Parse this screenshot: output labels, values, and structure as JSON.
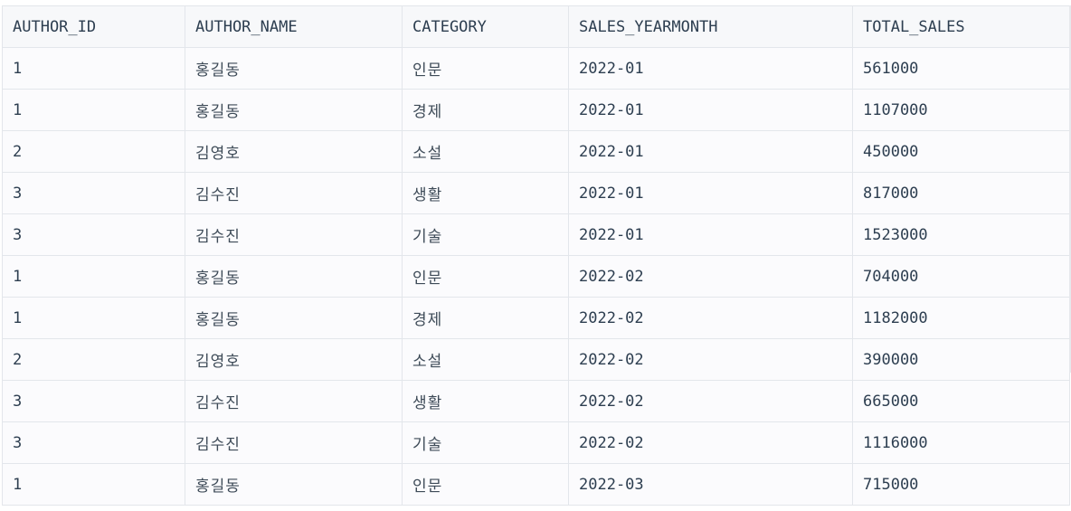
{
  "table": {
    "columns": [
      "AUTHOR_ID",
      "AUTHOR_NAME",
      "CATEGORY",
      "SALES_YEARMONTH",
      "TOTAL_SALES"
    ],
    "rows": [
      [
        "1",
        "홍길동",
        "인문",
        "2022-01",
        "561000"
      ],
      [
        "1",
        "홍길동",
        "경제",
        "2022-01",
        "1107000"
      ],
      [
        "2",
        "김영호",
        "소설",
        "2022-01",
        "450000"
      ],
      [
        "3",
        "김수진",
        "생활",
        "2022-01",
        "817000"
      ],
      [
        "3",
        "김수진",
        "기술",
        "2022-01",
        "1523000"
      ],
      [
        "1",
        "홍길동",
        "인문",
        "2022-02",
        "704000"
      ],
      [
        "1",
        "홍길동",
        "경제",
        "2022-02",
        "1182000"
      ],
      [
        "2",
        "김영호",
        "소설",
        "2022-02",
        "390000"
      ],
      [
        "3",
        "김수진",
        "생활",
        "2022-02",
        "665000"
      ],
      [
        "3",
        "김수진",
        "기술",
        "2022-02",
        "1116000"
      ],
      [
        "1",
        "홍길동",
        "인문",
        "2022-03",
        "715000"
      ]
    ]
  }
}
